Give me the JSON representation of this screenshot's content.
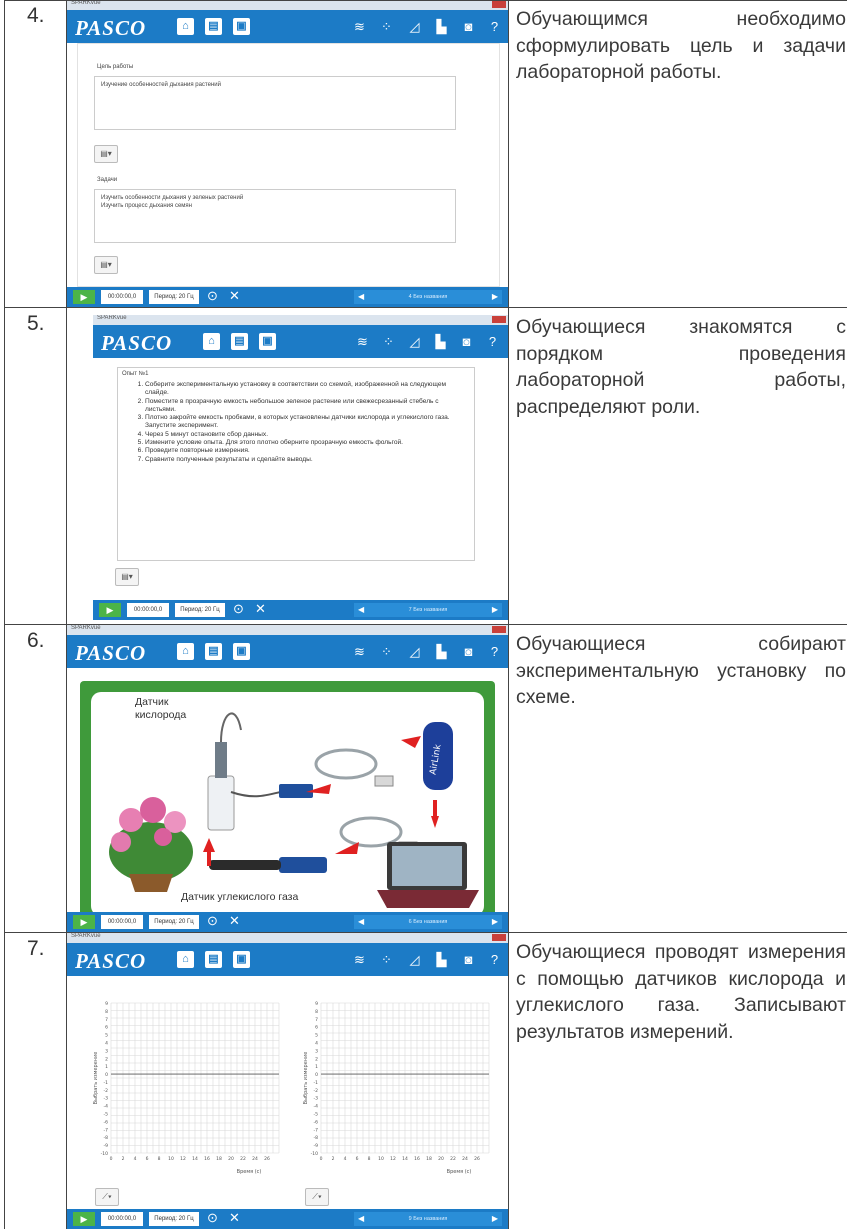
{
  "rows": [
    {
      "number": "4.",
      "description": "Обучающимся необходимо сформулировать цель и задачи лабораторной работы.",
      "app": {
        "window_title": "SPARKvue",
        "logo": "PASCO",
        "goal_label": "Цель работы",
        "goal_text": "Изучение особенностей дыхания растений",
        "tasks_label": "Задачи",
        "tasks_text_1": "Изучить особенности дыхания у зеленых растений",
        "tasks_text_2": "Изучить процесс дыхания семян",
        "time": "00:00:00,0",
        "rate": "Период: 20 Гц",
        "page": "4 Без названия"
      }
    },
    {
      "number": "5.",
      "description": "Обучающиеся знакомятся с порядком проведения лабораторной работы, распределяют роли.",
      "app": {
        "window_title": "SPARKvue",
        "logo": "PASCO",
        "heading": "Опыт №1",
        "steps": [
          "Соберите экспериментальную установку в соответствии со схемой, изображенной на следующем слайде.",
          "Поместите в прозрачную емкость небольшое зеленое растение или свежесрезанный стебель с листьями.",
          "Плотно закройте емкость пробками, в которых установлены датчики кислорода и углекислого газа. Запустите эксперимент.",
          "Через 5 минут остановите сбор данных.",
          "Измените условие опыта. Для этого плотно оберните прозрачную емкость фольгой.",
          "Проведите повторные измерения.",
          "Сравните полученные результаты и сделайте выводы."
        ],
        "time": "00:00:00,0",
        "rate": "Период: 20 Гц",
        "page": "7 Без названия"
      }
    },
    {
      "number": "6.",
      "description": "Обучающиеся собирают экспериментальную установку по схеме.",
      "app": {
        "window_title": "SPARKvue",
        "logo": "PASCO",
        "oxygen_sensor_label": "Датчик кислорода",
        "co2_sensor_label": "Датчик углекислого газа",
        "airlink_label": "AirLink",
        "time": "00:00:00,0",
        "rate": "Период: 20 Гц",
        "page": "6 Без названия"
      }
    },
    {
      "number": "7.",
      "description": "Обучающиеся проводят измерения с помощью датчиков кислорода и углекислого газа. Записывают результатов измерений.",
      "app": {
        "window_title": "SPARKvue",
        "logo": "PASCO",
        "y_axis_label": "Выбрать измерение",
        "x_axis_label": "Время (с)",
        "y_ticks": [
          "9",
          "8",
          "7",
          "6",
          "5",
          "4",
          "3",
          "2",
          "1",
          "0",
          "-1",
          "-2",
          "-3",
          "-4",
          "-5",
          "-6",
          "-7",
          "-8",
          "-9",
          "-10"
        ],
        "x_ticks": [
          "0",
          "2",
          "4",
          "6",
          "8",
          "10",
          "12",
          "14",
          "16",
          "18",
          "20",
          "22",
          "24",
          "26"
        ],
        "time": "00:00:00,0",
        "rate": "Период: 20 Гц",
        "page": "9 Без названия"
      }
    }
  ]
}
